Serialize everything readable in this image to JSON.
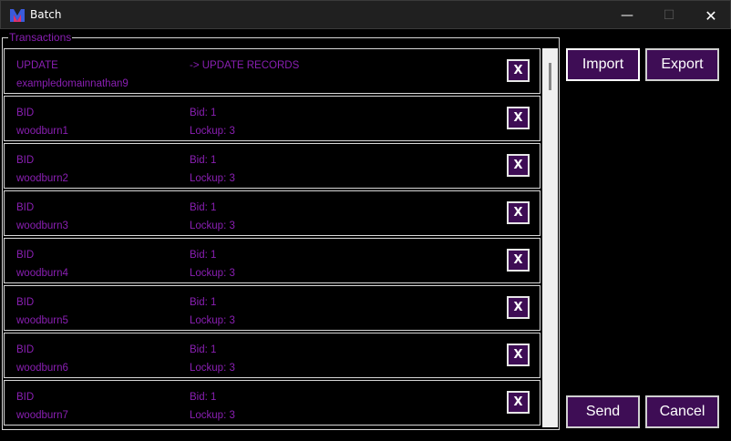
{
  "window": {
    "title": "Batch",
    "minimize_glyph": "—",
    "maximize_glyph": "☐",
    "close_glyph": "✕",
    "icon": "app-logo-icon"
  },
  "group": {
    "label": "Transactions"
  },
  "transactions": [
    {
      "type": "UPDATE",
      "name": "exampledomainnathan9",
      "line1": "-> UPDATE RECORDS",
      "line2": ""
    },
    {
      "type": "BID",
      "name": "woodburn1",
      "line1": "Bid: 1",
      "line2": "Lockup: 3"
    },
    {
      "type": "BID",
      "name": "woodburn2",
      "line1": "Bid: 1",
      "line2": "Lockup: 3"
    },
    {
      "type": "BID",
      "name": "woodburn3",
      "line1": "Bid: 1",
      "line2": "Lockup: 3"
    },
    {
      "type": "BID",
      "name": "woodburn4",
      "line1": "Bid: 1",
      "line2": "Lockup: 3"
    },
    {
      "type": "BID",
      "name": "woodburn5",
      "line1": "Bid: 1",
      "line2": "Lockup: 3"
    },
    {
      "type": "BID",
      "name": "woodburn6",
      "line1": "Bid: 1",
      "line2": "Lockup: 3"
    },
    {
      "type": "BID",
      "name": "woodburn7",
      "line1": "Bid: 1",
      "line2": "Lockup: 3"
    }
  ],
  "remove_label": "X",
  "buttons": {
    "import": "Import",
    "export": "Export",
    "send": "Send",
    "cancel": "Cancel"
  },
  "colors": {
    "accent_text": "#8a1fb3",
    "button_bg": "#3e0d55",
    "background": "#000000"
  }
}
